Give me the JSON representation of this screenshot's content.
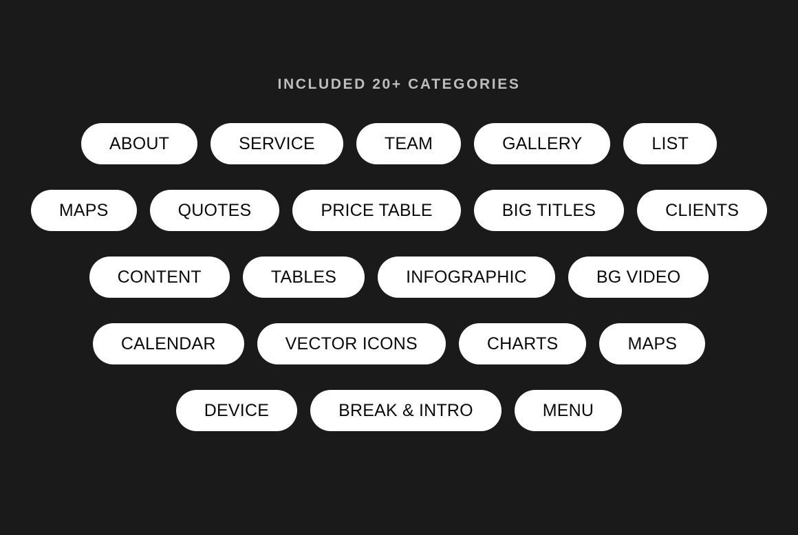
{
  "theme": {
    "background_color": "#1a1a1a",
    "pill_background_color": "#ffffff",
    "pill_text_color": "#0a0a0a",
    "title_color": "#bdbdbd"
  },
  "header": {
    "title": "INCLUDED 20+ CATEGORIES"
  },
  "categories": {
    "rows": [
      {
        "items": [
          {
            "label": "ABOUT"
          },
          {
            "label": "SERVICE"
          },
          {
            "label": "TEAM"
          },
          {
            "label": "GALLERY"
          },
          {
            "label": "LIST"
          }
        ]
      },
      {
        "items": [
          {
            "label": "MAPS"
          },
          {
            "label": "QUOTES"
          },
          {
            "label": "PRICE TABLE"
          },
          {
            "label": "BIG TITLES"
          },
          {
            "label": "CLIENTS"
          }
        ]
      },
      {
        "items": [
          {
            "label": "CONTENT"
          },
          {
            "label": "TABLES"
          },
          {
            "label": "INFOGRAPHIC"
          },
          {
            "label": "BG VIDEO"
          }
        ]
      },
      {
        "items": [
          {
            "label": "CALENDAR"
          },
          {
            "label": "VECTOR ICONS"
          },
          {
            "label": "CHARTS"
          },
          {
            "label": "MAPS"
          }
        ]
      },
      {
        "items": [
          {
            "label": "DEVICE"
          },
          {
            "label": "BREAK & INTRO"
          },
          {
            "label": "MENU"
          }
        ]
      }
    ]
  }
}
